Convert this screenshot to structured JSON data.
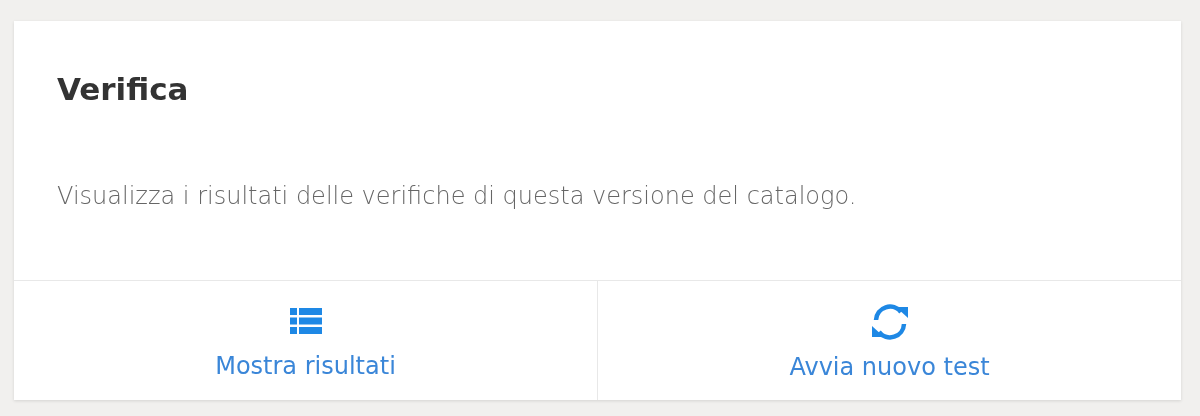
{
  "card": {
    "title": "Verifica",
    "description": "Visualizza i risultati delle verifiche di questa versione del catalogo.",
    "actions": [
      {
        "kind": "list",
        "label": "Mostra risultati"
      },
      {
        "kind": "refresh",
        "label": "Avvia nuovo test"
      }
    ]
  }
}
